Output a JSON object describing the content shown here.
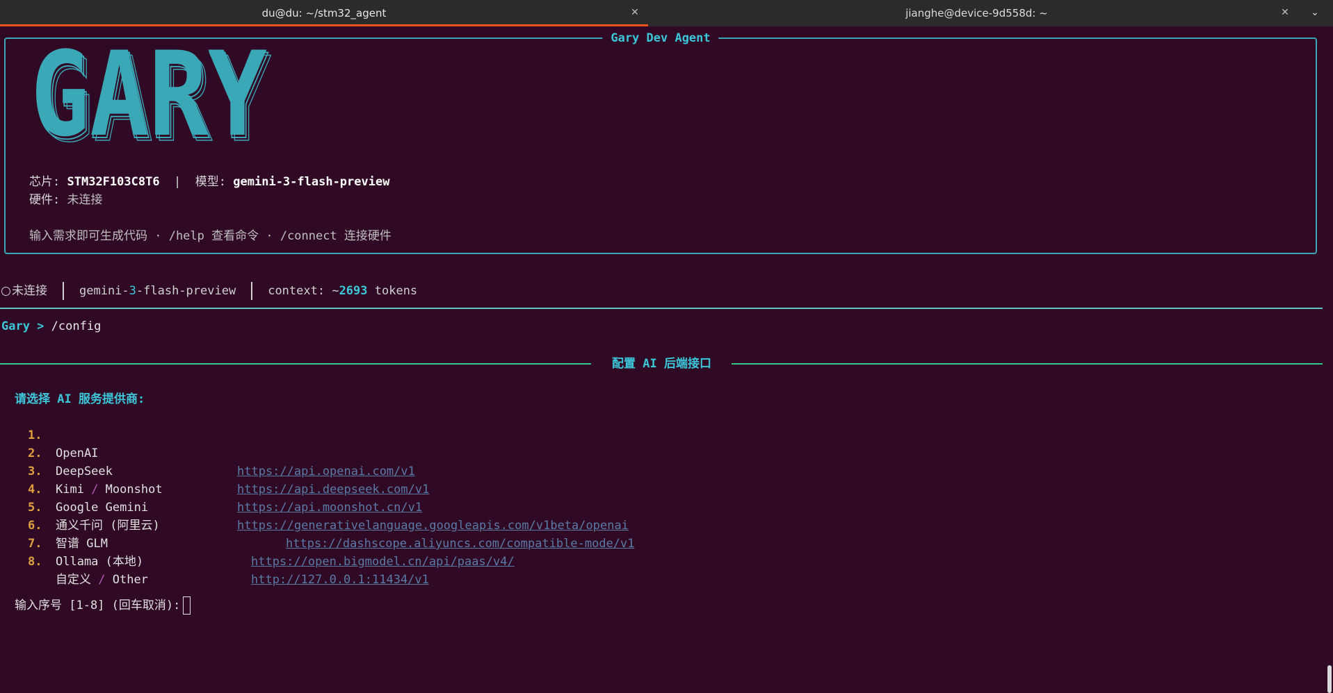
{
  "tabs": [
    {
      "title": "du@du: ~/stm32_agent",
      "active": true,
      "close_icon": "close-icon"
    },
    {
      "title": "jianghe@device-9d558d: ~",
      "active": false,
      "close_icon": "close-icon"
    }
  ],
  "panel": {
    "title": "Gary Dev Agent",
    "logo_text": "GARY",
    "chip_label": "芯片:",
    "chip_value": "STM32F103C8T6",
    "pipe": "|",
    "model_label": "模型:",
    "model_value": "gemini-3-flash-preview",
    "hw_label": "硬件:",
    "hw_value": "未连接",
    "hint": "输入需求即可生成代码 · /help 查看命令 · /connect 连接硬件"
  },
  "status": {
    "conn": "未连接",
    "model_a": "gemini-",
    "model_b": "3",
    "model_c": "-flash-preview",
    "context_prefix": "context: ~",
    "context_num": "2693",
    "context_suffix": " tokens"
  },
  "prompt": {
    "label": "Gary > ",
    "command": "/config"
  },
  "section": {
    "title": "配置 AI 后端接口"
  },
  "choose_label": "请选择 AI 服务提供商:",
  "providers": [
    {
      "num": "1.",
      "name": "OpenAI",
      "url": "https://api.openai.com/v1"
    },
    {
      "num": "2.",
      "name": "DeepSeek",
      "url": "https://api.deepseek.com/v1"
    },
    {
      "num": "3.",
      "name_a": "Kimi ",
      "slash": "/",
      "name_b": " Moonshot",
      "url": "https://api.moonshot.cn/v1"
    },
    {
      "num": "4.",
      "name": "Google Gemini",
      "url": "https://generativelanguage.googleapis.com/v1beta/openai"
    },
    {
      "num": "5.",
      "name": "通义千问 (阿里云)",
      "url": "https://dashscope.aliyuncs.com/compatible-mode/v1"
    },
    {
      "num": "6.",
      "name": "智谱 GLM",
      "url": "https://open.bigmodel.cn/api/paas/v4/"
    },
    {
      "num": "7.",
      "name": "Ollama (本地)",
      "url": "http://127.0.0.1:11434/v1"
    },
    {
      "num": "8.",
      "name_a": "自定义 ",
      "slash": "/",
      "name_b": " Other"
    }
  ],
  "input_prompt": "输入序号 [1-8] (回车取消):",
  "colors": {
    "background": "#300a24",
    "accent_cyan": "#3cc6d8",
    "tab_underline": "#e95420",
    "number_orange": "#e0a040",
    "link_blue": "#5a7aa8",
    "slash_purple": "#b05ab8"
  }
}
